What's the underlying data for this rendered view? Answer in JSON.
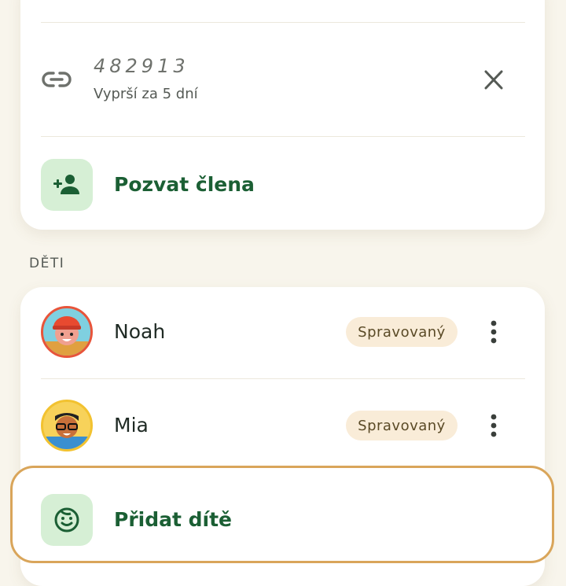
{
  "invite": {
    "code": "482913",
    "expires": "Vyprší za 5 dní",
    "invite_member_label": "Pozvat člena"
  },
  "kids_section": {
    "title": "DĚTI",
    "children": [
      {
        "name": "Noah",
        "badge": "Spravovaný"
      },
      {
        "name": "Mia",
        "badge": "Spravovaný"
      }
    ],
    "add_child_label": "Přidat dítě"
  },
  "colors": {
    "accent_green": "#1b5f34",
    "tile_bg": "#d6efd5",
    "badge_bg": "#f9ecd8",
    "highlight_border": "#d9a55a"
  },
  "icons": [
    "link-icon",
    "close-icon",
    "person-add-icon",
    "more-vert-icon",
    "child-face-icon"
  ]
}
